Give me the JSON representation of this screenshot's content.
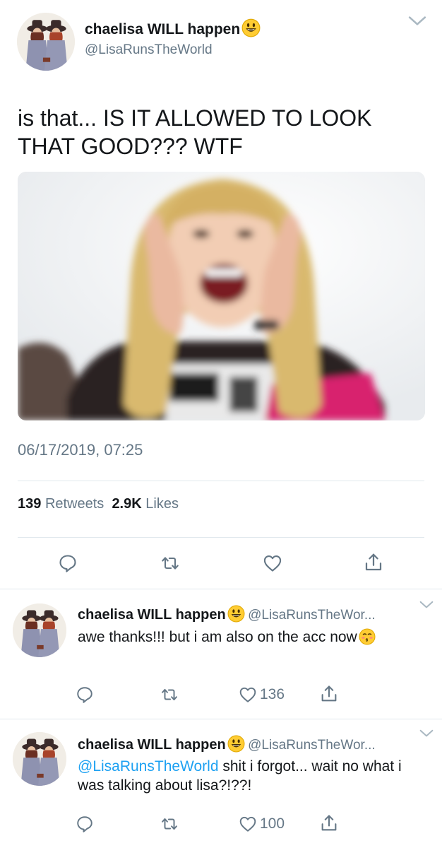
{
  "main": {
    "display_name": "chaelisa WILL happen",
    "handle": "@LisaRunsTheWorld",
    "text": "is that... IS IT ALLOWED TO LOOK THAT GOOD??? WTF",
    "timestamp": "06/17/2019, 07:25",
    "retweets_count": "139",
    "retweets_label": "Retweets",
    "likes_count": "2.9K",
    "likes_label": "Likes"
  },
  "replies": [
    {
      "display_name": "chaelisa WILL happen",
      "handle": "@LisaRunsTheWor...",
      "mention": "",
      "text": "awe thanks!!! but i am also on the acc now",
      "likes": "136"
    },
    {
      "display_name": "chaelisa WILL happen",
      "handle": "@LisaRunsTheWor...",
      "mention": "@LisaRunsTheWorld",
      "text": " shit i forgot... wait no what i was talking about lisa?!??!",
      "likes": "100"
    }
  ],
  "icons": {
    "reply": "reply-icon",
    "retweet": "retweet-icon",
    "like": "heart-icon",
    "share": "share-icon",
    "more": "chevron-down-icon"
  },
  "colors": {
    "link": "#1da1f2",
    "secondary_text": "#657786",
    "divider": "#e1e8ed"
  }
}
